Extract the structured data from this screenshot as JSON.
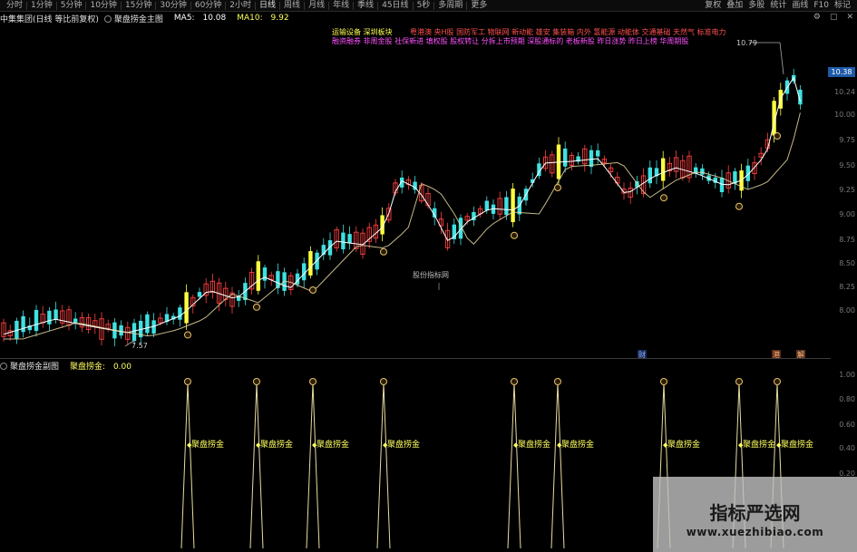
{
  "toolbar": {
    "left_items": [
      "分时",
      "1分钟",
      "5分钟",
      "10分钟",
      "15分钟",
      "30分钟",
      "60分钟",
      "2小时",
      "日线",
      "周线",
      "月线",
      "年线",
      "季线",
      "45日线",
      "5秒",
      "多周期",
      "更多"
    ],
    "active_index": 8,
    "right_items": [
      "复权",
      "叠加",
      "多股",
      "统计",
      "画线",
      "F10",
      "标记"
    ]
  },
  "main_header": {
    "stock": "中集集团(日线 等比前复权)",
    "indicator": "聚盘捞金主图",
    "ma5_label": "MA5:",
    "ma5_value": "10.08",
    "ma10_label": "MA10:",
    "ma10_value": "9.92"
  },
  "right_icons": [
    "⚙",
    "▢",
    "✕"
  ],
  "news": {
    "yellow": "运输设备    深圳板块",
    "red": "粤港澳 央H股 国防军工 物联网 新动能   雄安 集装箱 内外 氢能源 动能体 交通基础 天然气 标准电力",
    "magenta": "融资融券 非周金股 社保新进 填权股 股权转让 分拆上市预期 深股通标的 老板新股 昨日涨势 昨日上榜 华周期股"
  },
  "markers": {
    "high": "10.79",
    "low": "7.57",
    "center_label": "股份指标网"
  },
  "price_tag": "10.38",
  "axis_main": [
    "10.24",
    "10.00",
    "9.75",
    "9.50",
    "9.25",
    "9.00",
    "8.75",
    "8.50",
    "8.25",
    "8.00"
  ],
  "axis_sub": [
    "1.00",
    "0.80",
    "0.60",
    "0.40",
    "0.20"
  ],
  "sub_header": {
    "indicator": "聚盘捞金副图",
    "value_label": "聚盘捞金:",
    "value": "0.00"
  },
  "signal_label": "聚盘捞金",
  "event_badges": [
    "财",
    "港",
    "解"
  ],
  "watermark": {
    "title": "指标严选网",
    "url": "www.xuezhibiao.com"
  },
  "colors": {
    "up": "#ff4040",
    "down": "#40e0e0",
    "signal_bar": "#ffff40",
    "ma5": "#ffffff",
    "ma10": "#e8d8a0",
    "signal_line": "#e8dca0",
    "coin": "#e8c070"
  }
}
